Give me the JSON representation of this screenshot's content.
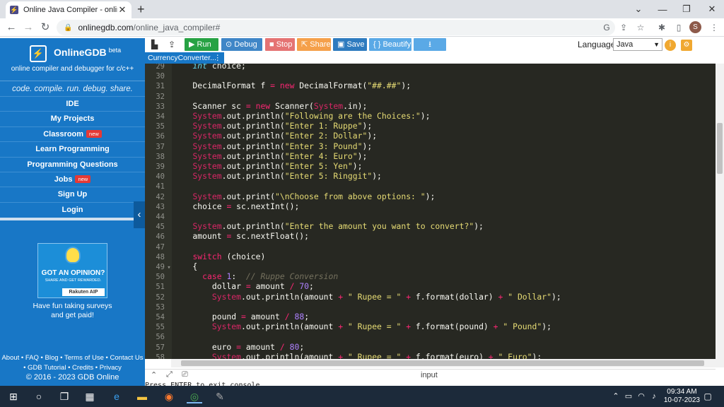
{
  "browser": {
    "tab_title": "Online Java Compiler - online ed",
    "url_domain": "onlinegdb.com",
    "url_path": "/online_java_compiler#",
    "profile_initial": "S"
  },
  "sidebar": {
    "brand_name": "OnlineGDB",
    "brand_beta": "beta",
    "brand_sub": "online compiler and debugger for c/c++",
    "tagline": "code. compile. run. debug. share.",
    "items": [
      {
        "label": "IDE",
        "badge": ""
      },
      {
        "label": "My Projects",
        "badge": ""
      },
      {
        "label": "Classroom",
        "badge": "new"
      },
      {
        "label": "Learn Programming",
        "badge": ""
      },
      {
        "label": "Programming Questions",
        "badge": ""
      },
      {
        "label": "Jobs",
        "badge": "new"
      },
      {
        "label": "Sign Up",
        "badge": ""
      },
      {
        "label": "Login",
        "badge": ""
      }
    ],
    "ad_title": "GOT AN OPINION?",
    "ad_sub": "SHARE AND GET REWARDED.",
    "ad_brand": "Rakuten AIP",
    "ad_text_1": "Have fun taking surveys",
    "ad_text_2": "and get paid!",
    "footer_line1": "About • FAQ • Blog • Terms of Use • Contact Us",
    "footer_line2": "• GDB Tutorial • Credits • Privacy",
    "copyright": "© 2016 - 2023 GDB Online"
  },
  "toolbar": {
    "run": "Run",
    "debug": "Debug",
    "stop": "Stop",
    "share": "Share",
    "save": "Save",
    "beautify": "{ } Beautify",
    "language_label": "Language",
    "language_value": "Java",
    "colors": {
      "run": "#27a244",
      "debug": "#3f86c7",
      "stop": "#e57373",
      "share": "#f5a04a",
      "save": "#2e7bbf",
      "beautify": "#5aa9e6",
      "download": "#5aa9e6"
    }
  },
  "file_tab": "CurrencyConverter...",
  "editor": {
    "lines": [
      {
        "n": "29",
        "html": "    <span class='t'>int</span> choice;"
      },
      {
        "n": "30",
        "html": ""
      },
      {
        "n": "31",
        "html": "    DecimalFormat f <span class='o'>=</span> <span class='k'>new</span> DecimalFormat(<span class='s'>\"##.##\"</span>);"
      },
      {
        "n": "32",
        "html": ""
      },
      {
        "n": "33",
        "html": "    Scanner sc <span class='o'>=</span> <span class='k'>new</span> Scanner(<span class='sys'>System</span>.in);"
      },
      {
        "n": "34",
        "html": "    <span class='sys'>System</span>.out.println(<span class='s'>\"Following are the Choices:\"</span>);"
      },
      {
        "n": "35",
        "html": "    <span class='sys'>System</span>.out.println(<span class='s'>\"Enter 1: Ruppe\"</span>);"
      },
      {
        "n": "36",
        "html": "    <span class='sys'>System</span>.out.println(<span class='s'>\"Enter 2: Dollar\"</span>);"
      },
      {
        "n": "37",
        "html": "    <span class='sys'>System</span>.out.println(<span class='s'>\"Enter 3: Pound\"</span>);"
      },
      {
        "n": "38",
        "html": "    <span class='sys'>System</span>.out.println(<span class='s'>\"Enter 4: Euro\"</span>);"
      },
      {
        "n": "39",
        "html": "    <span class='sys'>System</span>.out.println(<span class='s'>\"Enter 5: Yen\"</span>);"
      },
      {
        "n": "40",
        "html": "    <span class='sys'>System</span>.out.println(<span class='s'>\"Enter 5: Ringgit\"</span>);"
      },
      {
        "n": "41",
        "html": ""
      },
      {
        "n": "42",
        "html": "    <span class='sys'>System</span>.out.print(<span class='s'>\"\\nChoose from above options: \"</span>);"
      },
      {
        "n": "43",
        "html": "    choice <span class='o'>=</span> sc.nextInt();"
      },
      {
        "n": "44",
        "html": ""
      },
      {
        "n": "45",
        "html": "    <span class='sys'>System</span>.out.println(<span class='s'>\"Enter the amount you want to convert?\"</span>);"
      },
      {
        "n": "46",
        "html": "    amount <span class='o'>=</span> sc.nextFloat();"
      },
      {
        "n": "47",
        "html": ""
      },
      {
        "n": "48",
        "html": "    <span class='k'>switch</span> (choice)"
      },
      {
        "n": "49",
        "html": "    {",
        "fold": "▾"
      },
      {
        "n": "50",
        "html": "      <span class='k'>case</span> <span class='n'>1</span>:  <span class='c'>// Ruppe Conversion</span>"
      },
      {
        "n": "51",
        "html": "        dollar <span class='o'>=</span> amount <span class='o'>/</span> <span class='n'>70</span>;"
      },
      {
        "n": "52",
        "html": "        <span class='sys'>System</span>.out.println(amount <span class='o'>+</span> <span class='s'>\" Rupee = \"</span> <span class='o'>+</span> f.format(dollar) <span class='o'>+</span> <span class='s'>\" Dollar\"</span>);"
      },
      {
        "n": "53",
        "html": ""
      },
      {
        "n": "54",
        "html": "        pound <span class='o'>=</span> amount <span class='o'>/</span> <span class='n'>88</span>;"
      },
      {
        "n": "55",
        "html": "        <span class='sys'>System</span>.out.println(amount <span class='o'>+</span> <span class='s'>\" Rupee = \"</span> <span class='o'>+</span> f.format(pound) <span class='o'>+</span> <span class='s'>\" Pound\"</span>);"
      },
      {
        "n": "56",
        "html": ""
      },
      {
        "n": "57",
        "html": "        euro <span class='o'>=</span> amount <span class='o'>/</span> <span class='n'>80</span>;"
      },
      {
        "n": "58",
        "html": "        <span class='sys'>System</span>.out.println(amount <span class='o'>+</span> <span class='s'>\" Rupee = \"</span> <span class='o'>+</span> f.format(euro) <span class='o'>+</span> <span class='s'>\" Euro\"</span>);"
      }
    ]
  },
  "input_label": "input",
  "console_text": "Press ENTER to exit console.",
  "taskbar": {
    "time": "09:34 AM",
    "date": "10-07-2023"
  }
}
